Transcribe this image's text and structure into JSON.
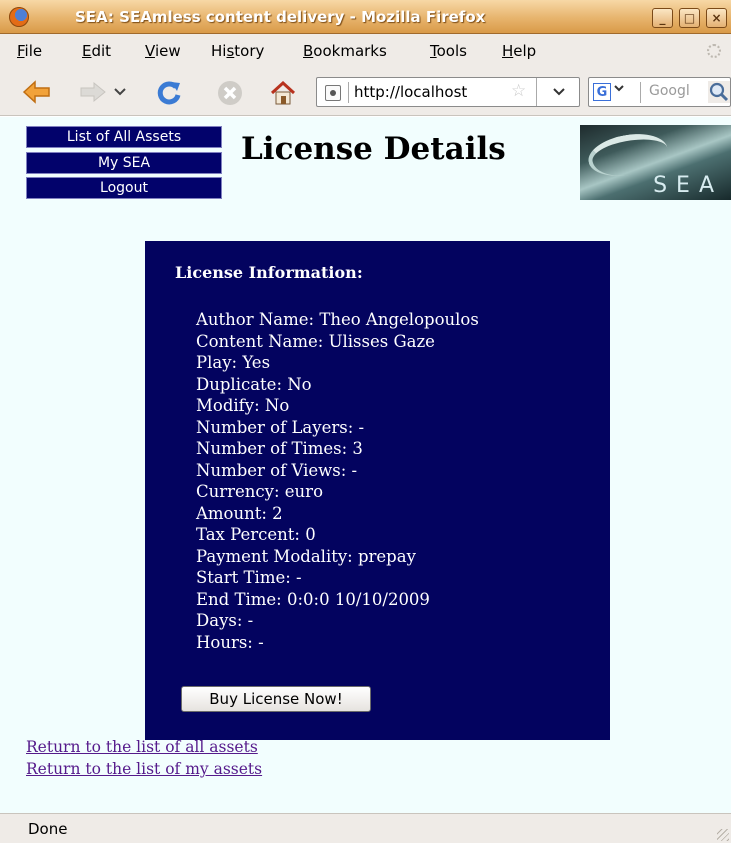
{
  "window": {
    "title": "SEA: SEAmless content delivery - Mozilla Firefox",
    "controls": [
      "_",
      "□",
      "×"
    ]
  },
  "menu": {
    "items": [
      {
        "mnemonic": "F",
        "rest": "ile"
      },
      {
        "mnemonic": "E",
        "rest": "dit"
      },
      {
        "mnemonic": "V",
        "rest": "iew"
      },
      {
        "prefix": "Hi",
        "mnemonic": "s",
        "rest": "tory"
      },
      {
        "mnemonic": "B",
        "rest": "ookmarks"
      },
      {
        "mnemonic": "T",
        "rest": "ools"
      },
      {
        "mnemonic": "H",
        "rest": "elp"
      }
    ]
  },
  "toolbar": {
    "icons": [
      "back-arrow-icon",
      "forward-arrow-icon",
      "history-dropdown-icon",
      "reload-icon",
      "stop-icon",
      "home-icon"
    ],
    "url": "http://localhost",
    "search_engine_letter": "G",
    "search_placeholder": "Googl"
  },
  "page": {
    "nav_buttons": [
      "List of All Assets",
      "My SEA",
      "Logout"
    ],
    "title": "License Details",
    "logo_text": "SEA",
    "license": {
      "heading": "License Information:",
      "lines": [
        "Author Name: Theo Angelopoulos",
        "Content Name: Ulisses Gaze",
        "Play: Yes",
        "Duplicate: No",
        "Modify: No",
        "Number of Layers: -",
        "Number of Times: 3",
        "Number of Views: -",
        "Currency: euro",
        "Amount: 2",
        "Tax Percent: 0",
        "Payment Modality: prepay",
        "Start Time: -",
        "End Time: 0:0:0 10/10/2009",
        "Days: -",
        "Hours: -"
      ],
      "buy_button": "Buy License Now!"
    },
    "links": [
      "Return to the list of all assets",
      "Return to the list of my assets"
    ]
  },
  "status": {
    "text": "Done"
  },
  "colors": {
    "title_bar": "#e7b46d",
    "nav_button_bg": "#02026b",
    "license_box_bg": "#03035f",
    "page_bg": "#f2fefe",
    "visited_link": "#551a8b"
  }
}
